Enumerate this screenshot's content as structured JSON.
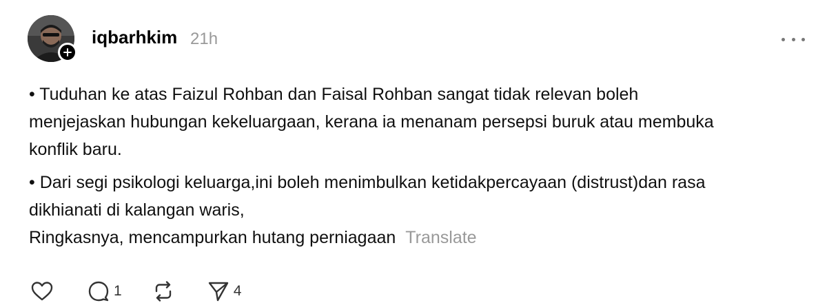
{
  "post": {
    "author": "iqbarhkim",
    "time": "21h",
    "paragraphs": [
      "• Tuduhan ke atas Faizul Rohban dan Faisal Rohban sangat tidak relevan boleh\nmenjejaskan hubungan kekeluargaan, kerana ia menanam persepsi buruk atau membuka\nkonflik baru.",
      "• Dari segi psikologi keluarga,ini boleh menimbulkan ketidakpercayaan (distrust)dan rasa\ndikhianati di kalangan waris,"
    ],
    "last_line": "Ringkasnya, mencampurkan hutang perniagaan",
    "translate_label": "Translate"
  },
  "actions": {
    "like_icon": "heart-icon",
    "reply_icon": "reply-icon",
    "reply_count": "1",
    "repost_icon": "repost-icon",
    "share_icon": "send-icon",
    "share_count": "4"
  },
  "colors": {
    "text": "#101010",
    "muted": "#999999",
    "badge": "#000000"
  }
}
